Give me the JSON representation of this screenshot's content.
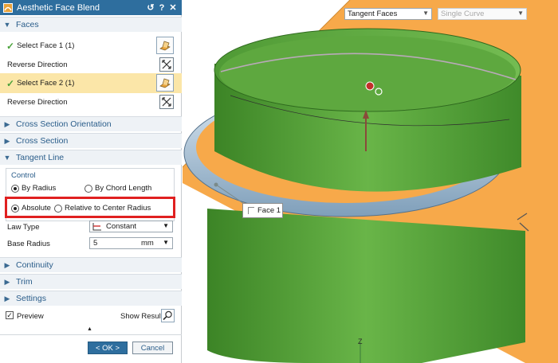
{
  "dialog": {
    "title": "Aesthetic Face Blend",
    "title_buttons": [
      "↺",
      "?",
      "✕"
    ],
    "sections": {
      "faces": "Faces",
      "cross_section_orientation": "Cross Section Orientation",
      "cross_section": "Cross Section",
      "tangent_line": "Tangent Line",
      "continuity": "Continuity",
      "trim": "Trim",
      "settings": "Settings"
    },
    "select_face_1": "Select Face 1 (1)",
    "reverse_direction_1": "Reverse Direction",
    "select_face_2": "Select Face 2 (1)",
    "reverse_direction_2": "Reverse Direction",
    "control_title": "Control",
    "by_radius": "By Radius",
    "by_chord_length": "By Chord Length",
    "absolute": "Absolute",
    "relative_to_center_radius": "Relative to Center Radius",
    "law_type_label": "Law Type",
    "law_type_value": "Constant",
    "base_radius_label": "Base Radius",
    "base_radius_value": "5",
    "base_radius_unit": "mm",
    "preview_label": "Preview",
    "show_result_label": "Show Result",
    "ok_label": "< OK >",
    "cancel_label": "Cancel"
  },
  "viewport": {
    "filter_select": "Tangent Faces",
    "curve_select": "Single Curve",
    "face_label": "Face 1",
    "axis_label": "Z"
  },
  "colors": {
    "title_bar": "#2e6e9e",
    "section_text": "#2a5d8a",
    "highlight_row": "#fbe6a8",
    "annotation_box": "#e02020",
    "plane": "#f7a94a",
    "cylinder": "#5aa33c",
    "blend": "#a9c5dc"
  }
}
